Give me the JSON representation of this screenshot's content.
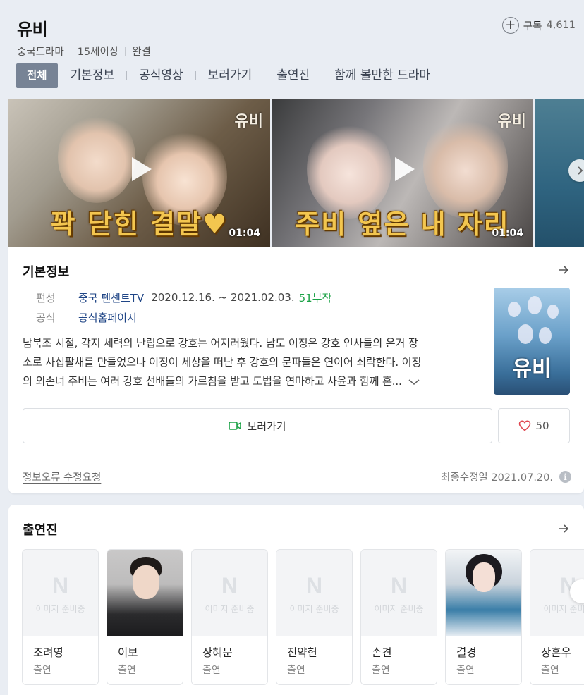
{
  "header": {
    "title": "유비",
    "meta": [
      "중국드라마",
      "15세이상",
      "완결"
    ],
    "subscribe_label": "구독",
    "subscribe_count": "4,611"
  },
  "tabs": [
    {
      "label": "전체",
      "active": true
    },
    {
      "label": "기본정보"
    },
    {
      "label": "공식영상"
    },
    {
      "label": "보러가기"
    },
    {
      "label": "출연진"
    },
    {
      "label": "함께 볼만한 드라마"
    }
  ],
  "videos": [
    {
      "caption": "꽉 닫힌 결말♥",
      "duration": "01:04",
      "logo": "유비"
    },
    {
      "caption": "주비 옆은 내 자리",
      "duration": "01:04",
      "logo": "유비"
    }
  ],
  "basic_info": {
    "heading": "기본정보",
    "broadcast_label": "편성",
    "broadcaster": "중국 텐센트TV",
    "dates": "2020.12.16. ~ 2021.02.03.",
    "episodes": "51부작",
    "official_label": "공식",
    "official_link": "공식홈페이지",
    "synopsis_lines": [
      "남북조 시절, 각지 세력의 난립으로 강호는 어지러웠다. 남도 이징은 강호 인사들의 은거 장",
      "소로 사십팔채를 만들었으나 이징이 세상을 떠난 후 강호의 문파들은 연이어 쇠락한다. 이징",
      "의 외손녀 주비는 여러 강호 선배들의 가르침을 받고 도법을 연마하고 사윤과 함께 혼..."
    ],
    "poster_title": "유비",
    "watch_label": "보러가기",
    "like_count": "50",
    "report_label": "정보오류 수정요청",
    "updated": "최종수정일 2021.07.20."
  },
  "cast": {
    "heading": "출연진",
    "placeholder_text": "이미지 준비중",
    "people": [
      {
        "name": "조려영",
        "role": "출연",
        "photo": "none"
      },
      {
        "name": "이보",
        "role": "출연",
        "photo": "male"
      },
      {
        "name": "장혜문",
        "role": "출연",
        "photo": "none"
      },
      {
        "name": "진약헌",
        "role": "출연",
        "photo": "none"
      },
      {
        "name": "손견",
        "role": "출연",
        "photo": "none"
      },
      {
        "name": "결경",
        "role": "출연",
        "photo": "female"
      },
      {
        "name": "장흔우",
        "role": "출연",
        "photo": "none"
      }
    ]
  },
  "colors": {
    "accent_green": "#1ba246",
    "link_blue": "#1f4586",
    "tab_active_bg": "#778395",
    "heart": "#e0454f"
  }
}
